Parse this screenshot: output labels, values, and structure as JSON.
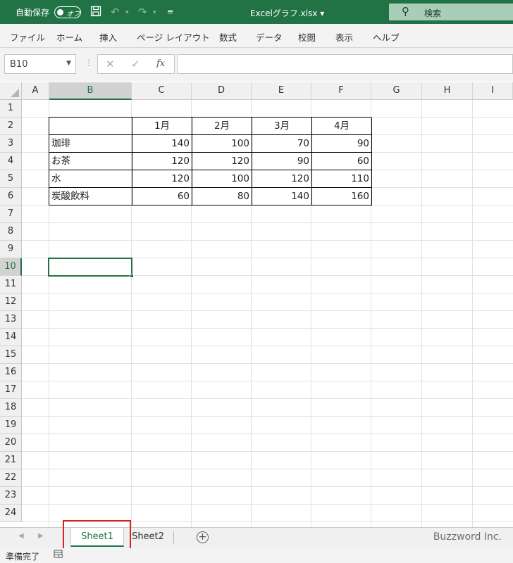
{
  "titlebar": {
    "autosave_label": "自動保存",
    "autosave_state": "オフ",
    "filename": "Excelグラフ.xlsx",
    "filename_caret": "▾",
    "search_placeholder": "検索"
  },
  "ribbon": {
    "tabs": [
      "ファイル",
      "ホーム",
      "挿入",
      "ページ レイアウト",
      "数式",
      "データ",
      "校閲",
      "表示",
      "ヘルプ"
    ]
  },
  "formula_bar": {
    "name_box": "B10",
    "fx_label": "fx",
    "formula": ""
  },
  "grid": {
    "columns": [
      "A",
      "B",
      "C",
      "D",
      "E",
      "F",
      "G",
      "H",
      "I"
    ],
    "selected_column": "B",
    "rows": [
      "1",
      "2",
      "3",
      "4",
      "5",
      "6",
      "7",
      "8",
      "9",
      "10",
      "11",
      "12",
      "13",
      "14",
      "15",
      "16",
      "17",
      "18",
      "19",
      "20",
      "21",
      "22",
      "23",
      "24"
    ],
    "selected_row": "10",
    "table": {
      "headers": [
        "",
        "1月",
        "2月",
        "3月",
        "4月"
      ],
      "rows": [
        {
          "label": "珈琲",
          "values": [
            "140",
            "100",
            "70",
            "90"
          ]
        },
        {
          "label": "お茶",
          "values": [
            "120",
            "120",
            "90",
            "60"
          ]
        },
        {
          "label": "水",
          "values": [
            "120",
            "100",
            "120",
            "110"
          ]
        },
        {
          "label": "炭酸飲料",
          "values": [
            "60",
            "80",
            "140",
            "160"
          ]
        }
      ]
    }
  },
  "sheet_tabs": {
    "tabs": [
      "Sheet1",
      "Sheet2"
    ],
    "active": "Sheet1",
    "add_label": "+",
    "watermark": "Buzzword Inc."
  },
  "status_bar": {
    "status": "準備完了"
  },
  "colors": {
    "accent": "#217346",
    "highlight_box": "#e02020"
  }
}
